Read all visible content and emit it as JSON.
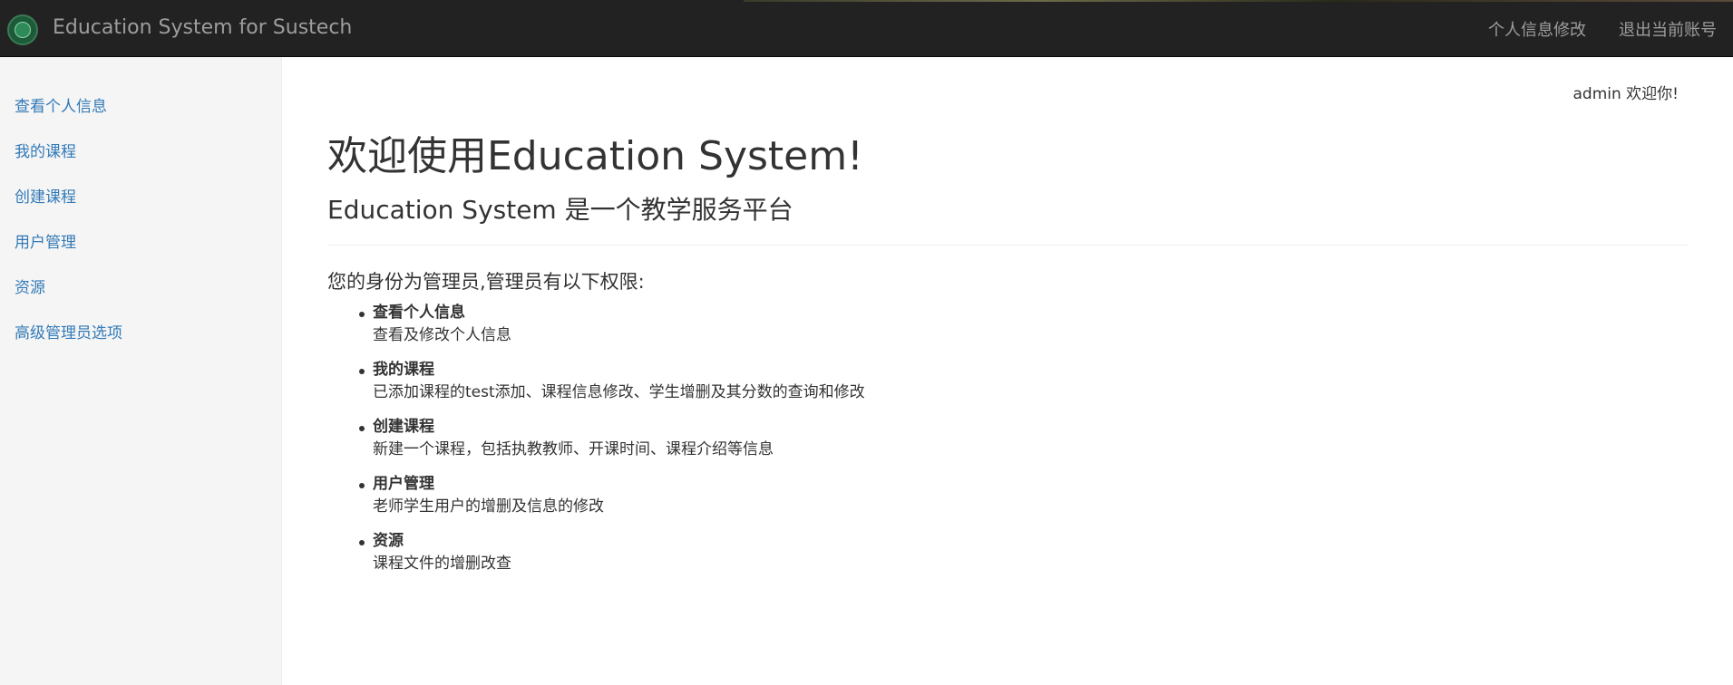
{
  "header": {
    "brand": "Education System for Sustech",
    "logo_icon": "sustech-logo-icon",
    "links": [
      "个人信息修改",
      "退出当前账号"
    ]
  },
  "sidebar": {
    "items": [
      {
        "label": "查看个人信息"
      },
      {
        "label": "我的课程"
      },
      {
        "label": "创建课程"
      },
      {
        "label": "用户管理"
      },
      {
        "label": "资源"
      },
      {
        "label": "高级管理员选项"
      }
    ]
  },
  "main": {
    "welcome_user": "admin 欢迎你!",
    "title": "欢迎使用Education System!",
    "subtitle": "Education System 是一个教学服务平台",
    "intro": "您的身份为管理员,管理员有以下权限:",
    "permissions": [
      {
        "title": "查看个人信息",
        "desc": "查看及修改个人信息"
      },
      {
        "title": "我的课程",
        "desc": "已添加课程的test添加、课程信息修改、学生增删及其分数的查询和修改"
      },
      {
        "title": "创建课程",
        "desc": "新建一个课程，包括执教教师、开课时间、课程介绍等信息"
      },
      {
        "title": "用户管理",
        "desc": "老师学生用户的增删及信息的修改"
      },
      {
        "title": "资源",
        "desc": "课程文件的增删改查"
      }
    ]
  },
  "colors": {
    "navbar_bg": "#222222",
    "nav_text": "#9d9d9d",
    "link": "#337ab7",
    "sidebar_bg": "#f5f5f5"
  }
}
